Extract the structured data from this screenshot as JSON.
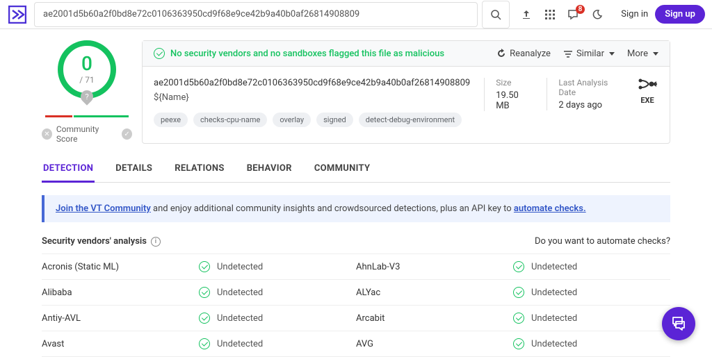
{
  "header": {
    "search_value": "ae2001d5b60a2f0bd8e72c0106363950cd9f68e9ce42b9a40b0af26814908809",
    "badge": "8",
    "signin": "Sign in",
    "signup": "Sign up"
  },
  "gauge": {
    "num": "0",
    "den": "/ 71"
  },
  "community_score": "Community Score",
  "banner": {
    "text": "No security vendors and no sandboxes flagged this file as malicious",
    "reanalyze": "Reanalyze",
    "similar": "Similar",
    "more": "More"
  },
  "file": {
    "hash": "ae2001d5b60a2f0bd8e72c0106363950cd9f68e9ce42b9a40b0af26814908809",
    "name": "${Name}",
    "tags": [
      "peexe",
      "checks-cpu-name",
      "overlay",
      "signed",
      "detect-debug-environment"
    ],
    "size_label": "Size",
    "size_value": "19.50 MB",
    "last_label": "Last Analysis Date",
    "last_value": "2 days ago",
    "type": "EXE"
  },
  "tabs": [
    "DETECTION",
    "DETAILS",
    "RELATIONS",
    "BEHAVIOR",
    "COMMUNITY"
  ],
  "promo": {
    "link1": "Join the VT Community",
    "mid": " and enjoy additional community insights and crowdsourced detections, plus an API key to ",
    "link2": "automate checks."
  },
  "sec_title": "Security vendors' analysis",
  "automate": "Do you want to automate checks?",
  "status": "Undetected",
  "vendors": [
    {
      "a": "Acronis (Static ML)",
      "b": "AhnLab-V3"
    },
    {
      "a": "Alibaba",
      "b": "ALYac"
    },
    {
      "a": "Antiy-AVL",
      "b": "Arcabit"
    },
    {
      "a": "Avast",
      "b": "AVG"
    }
  ]
}
